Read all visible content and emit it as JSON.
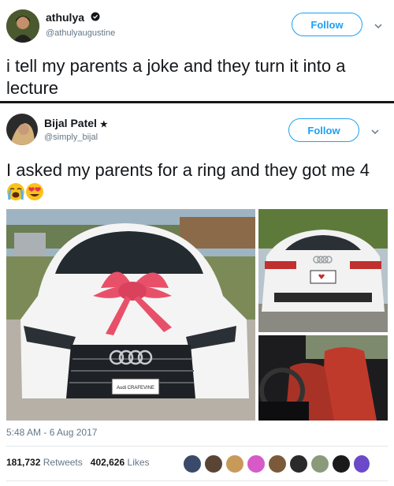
{
  "tweet1": {
    "display_name": "athulya",
    "handle": "@athulyaugustine",
    "follow_label": "Follow",
    "text": "i tell my parents a joke and they turn it into a lecture"
  },
  "tweet2": {
    "display_name": "Bijal Patel",
    "badge": "★",
    "handle": "@simply_bijal",
    "follow_label": "Follow",
    "text": "I asked my parents for a ring and they got me 4",
    "timestamp": "5:48 AM - 6 Aug 2017",
    "retweets_count": "181,732",
    "retweets_label": "Retweets",
    "likes_count": "402,626",
    "likes_label": "Likes",
    "plate_text": "Audi CRAFEVINE"
  },
  "colors": {
    "accent": "#1da1f2",
    "bow": "#e8506a",
    "car": "#f4f4f4"
  },
  "icons": {
    "verified": "verified-badge-icon",
    "chevron": "chevron-down-icon",
    "emoji1": "crying-face-icon",
    "emoji2": "heart-eyes-face-icon"
  }
}
